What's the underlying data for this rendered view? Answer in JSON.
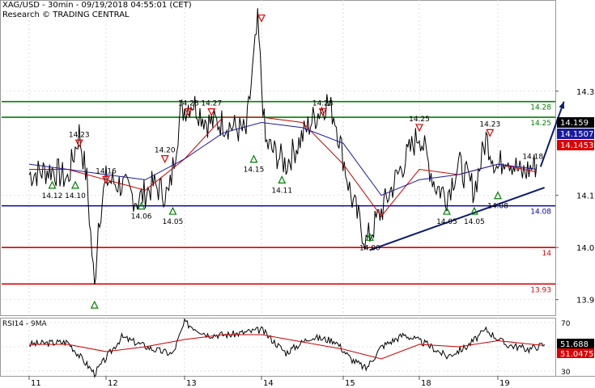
{
  "header": {
    "title": "XAG/USD - 30min - 09/19/2018 04:55:01 (CET)",
    "subtitle": "Research © TRADING CENTRAL"
  },
  "colors": {
    "price": "#000000",
    "ma_fast": "#cc0000",
    "ma_slow": "#1a1aa0",
    "resistance": "#008000",
    "pivot": "#0000aa",
    "support": "#dd0000",
    "arrow": "#0a1a70",
    "triangle_up": "#008000",
    "triangle_down": "#dd0000"
  },
  "chart_data": [
    {
      "type": "line",
      "name": "price",
      "ylim": [
        13.87,
        14.475
      ],
      "yticks": [
        "14.3",
        "14.1",
        "14.0",
        "13.9"
      ],
      "xticks": [
        "11",
        "12",
        "13",
        "14",
        "15",
        "18",
        "19"
      ],
      "levels": [
        {
          "value": 14.28,
          "label": "14.28",
          "role": "resistance"
        },
        {
          "value": 14.25,
          "label": "14.25",
          "role": "resistance"
        },
        {
          "value": 14.08,
          "label": "14.08",
          "role": "pivot"
        },
        {
          "value": 14.0,
          "label": "14",
          "role": "support"
        },
        {
          "value": 13.93,
          "label": "13.93",
          "role": "support"
        }
      ],
      "last_price_tags": [
        {
          "label": "14.159",
          "value": 14.159,
          "style": "black"
        },
        {
          "label": "14.1507",
          "value": 14.1507,
          "style": "blue"
        },
        {
          "label": "14.1453",
          "value": 14.1453,
          "style": "red"
        }
      ],
      "annotations": [
        {
          "label": "14.12",
          "x": 0.3,
          "y": 14.12,
          "mark": "up"
        },
        {
          "label": "14.10",
          "x": 0.6,
          "y": 14.12,
          "mark": "up"
        },
        {
          "label": "14.23",
          "x": 0.65,
          "y": 14.2,
          "mark": "down"
        },
        {
          "label": "14.16",
          "x": 1.0,
          "y": 14.13,
          "mark": "down"
        },
        {
          "label": "",
          "x": 0.85,
          "y": 13.89,
          "mark": "up"
        },
        {
          "label": "14.06",
          "x": 1.45,
          "y": 14.08,
          "mark": "up"
        },
        {
          "label": "14.20",
          "x": 1.75,
          "y": 14.17,
          "mark": "down"
        },
        {
          "label": "14.05",
          "x": 1.85,
          "y": 14.07,
          "mark": "up"
        },
        {
          "label": "14.28",
          "x": 2.05,
          "y": 14.26,
          "mark": "down"
        },
        {
          "label": "14.27",
          "x": 2.35,
          "y": 14.26,
          "mark": "down"
        },
        {
          "label": "14.15",
          "x": 2.9,
          "y": 14.17,
          "mark": "up"
        },
        {
          "label": "",
          "x": 3.0,
          "y": 14.44,
          "mark": "down"
        },
        {
          "label": "14.11",
          "x": 3.25,
          "y": 14.13,
          "mark": "up"
        },
        {
          "label": "14.28",
          "x": 3.75,
          "y": 14.26,
          "mark": "down"
        },
        {
          "label": "14.00",
          "x": 4.35,
          "y": 14.02,
          "mark": "up"
        },
        {
          "label": "14.25",
          "x": 5.0,
          "y": 14.23,
          "mark": "down"
        },
        {
          "label": "14.05",
          "x": 5.35,
          "y": 14.07,
          "mark": "up"
        },
        {
          "label": "14.05",
          "x": 5.7,
          "y": 14.07,
          "mark": "up"
        },
        {
          "label": "14.08",
          "x": 6.0,
          "y": 14.1,
          "mark": "up"
        },
        {
          "label": "14.23",
          "x": 5.9,
          "y": 14.22,
          "mark": "down"
        },
        {
          "label": "14.18",
          "x": 6.45,
          "y": 14.17,
          "mark": "none"
        }
      ],
      "trendline": [
        [
          4.35,
          13.995
        ],
        [
          6.6,
          14.115
        ]
      ],
      "forecast_arrow": [
        [
          6.55,
          14.155
        ],
        [
          6.85,
          14.28
        ]
      ],
      "series": [
        {
          "name": "price",
          "x": [
            0,
            0.3,
            0.5,
            0.65,
            0.75,
            0.85,
            0.9,
            1.0,
            1.2,
            1.4,
            1.6,
            1.8,
            1.95,
            2.1,
            2.3,
            2.5,
            2.8,
            2.95,
            3.05,
            3.3,
            3.6,
            3.8,
            3.9,
            4.1,
            4.3,
            4.5,
            4.75,
            5.0,
            5.2,
            5.35,
            5.5,
            5.7,
            5.85,
            6.0,
            6.1,
            6.3,
            6.5
          ],
          "values": [
            14.14,
            14.15,
            14.13,
            14.22,
            14.13,
            13.92,
            14.05,
            14.13,
            14.12,
            14.09,
            14.12,
            14.1,
            14.26,
            14.28,
            14.24,
            14.24,
            14.22,
            14.43,
            14.2,
            14.16,
            14.24,
            14.28,
            14.25,
            14.1,
            14.01,
            14.07,
            14.15,
            14.22,
            14.12,
            14.1,
            14.16,
            14.11,
            14.21,
            14.15,
            14.18,
            14.14,
            14.16
          ]
        },
        {
          "name": "ma_fast",
          "x": [
            0,
            0.5,
            1.0,
            1.5,
            2.0,
            2.5,
            3.0,
            3.5,
            4.0,
            4.5,
            5.0,
            5.5,
            6.0,
            6.5
          ],
          "values": [
            14.15,
            14.15,
            14.13,
            14.11,
            14.17,
            14.25,
            14.25,
            14.24,
            14.16,
            14.06,
            14.15,
            14.14,
            14.16,
            14.145
          ]
        },
        {
          "name": "ma_slow",
          "x": [
            0,
            0.5,
            1.0,
            1.5,
            2.0,
            2.5,
            3.0,
            3.5,
            4.0,
            4.5,
            5.0,
            5.5,
            6.0,
            6.5
          ],
          "values": [
            14.16,
            14.15,
            14.14,
            14.13,
            14.17,
            14.22,
            14.24,
            14.23,
            14.2,
            14.1,
            14.13,
            14.14,
            14.16,
            14.15
          ]
        }
      ]
    },
    {
      "type": "line",
      "name": "rsi",
      "title": "RSI14 - 9MA",
      "ylim": [
        26,
        74
      ],
      "yticks": [
        "70",
        "50",
        "30"
      ],
      "last_value_tags": [
        {
          "label": "51.688",
          "value": 51.688,
          "style": "black"
        },
        {
          "label": "51.0475",
          "value": 51.0475,
          "style": "red"
        }
      ],
      "series": [
        {
          "name": "RSI14",
          "x": [
            0,
            0.5,
            0.85,
            1.2,
            1.6,
            1.85,
            2.0,
            2.3,
            2.6,
            3.0,
            3.3,
            3.6,
            3.9,
            4.1,
            4.3,
            4.5,
            4.8,
            5.1,
            5.35,
            5.6,
            5.85,
            6.1,
            6.4,
            6.6
          ],
          "values": [
            52,
            54,
            28,
            58,
            48,
            44,
            70,
            60,
            60,
            64,
            45,
            58,
            55,
            40,
            32,
            50,
            60,
            52,
            42,
            50,
            64,
            52,
            48,
            52
          ]
        },
        {
          "name": "MA9",
          "x": [
            0,
            0.5,
            1.0,
            1.5,
            2.0,
            2.5,
            3.0,
            3.5,
            4.0,
            4.5,
            5.0,
            5.5,
            6.0,
            6.6
          ],
          "values": [
            52,
            52,
            46,
            50,
            56,
            60,
            60,
            54,
            48,
            40,
            52,
            50,
            55,
            51
          ]
        }
      ]
    }
  ]
}
